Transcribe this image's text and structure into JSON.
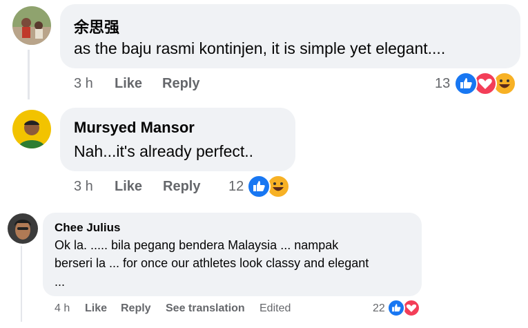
{
  "comments": [
    {
      "author": "余思强",
      "text": "as the baju rasmi kontinjen, it is simple yet elegant....",
      "time": "3 h",
      "like": "Like",
      "reply": "Reply",
      "reaction_count": "13",
      "reactions": [
        "like-icon",
        "love-icon",
        "haha-icon"
      ]
    },
    {
      "author": "Mursyed Mansor",
      "text": "Nah...it's already perfect..",
      "time": "3 h",
      "like": "Like",
      "reply": "Reply",
      "reaction_count": "12",
      "reactions": [
        "like-icon",
        "haha-icon"
      ]
    },
    {
      "author": "Chee Julius",
      "text_line1": "Ok la. ..... bila pegang bendera Malaysia ... nampak",
      "text_line2": "berseri la ... for once our athletes look classy and elegant",
      "text_line3": "...",
      "time": "4 h",
      "like": "Like",
      "reply": "Reply",
      "see_translation": "See translation",
      "edited": "Edited",
      "reaction_count": "22",
      "reactions": [
        "like-icon",
        "love-icon"
      ]
    }
  ],
  "colors": {
    "like": "#1877f2",
    "love": "#f33e58",
    "haha": "#f7b125",
    "bubble": "#f0f2f5",
    "meta": "#65676b"
  }
}
